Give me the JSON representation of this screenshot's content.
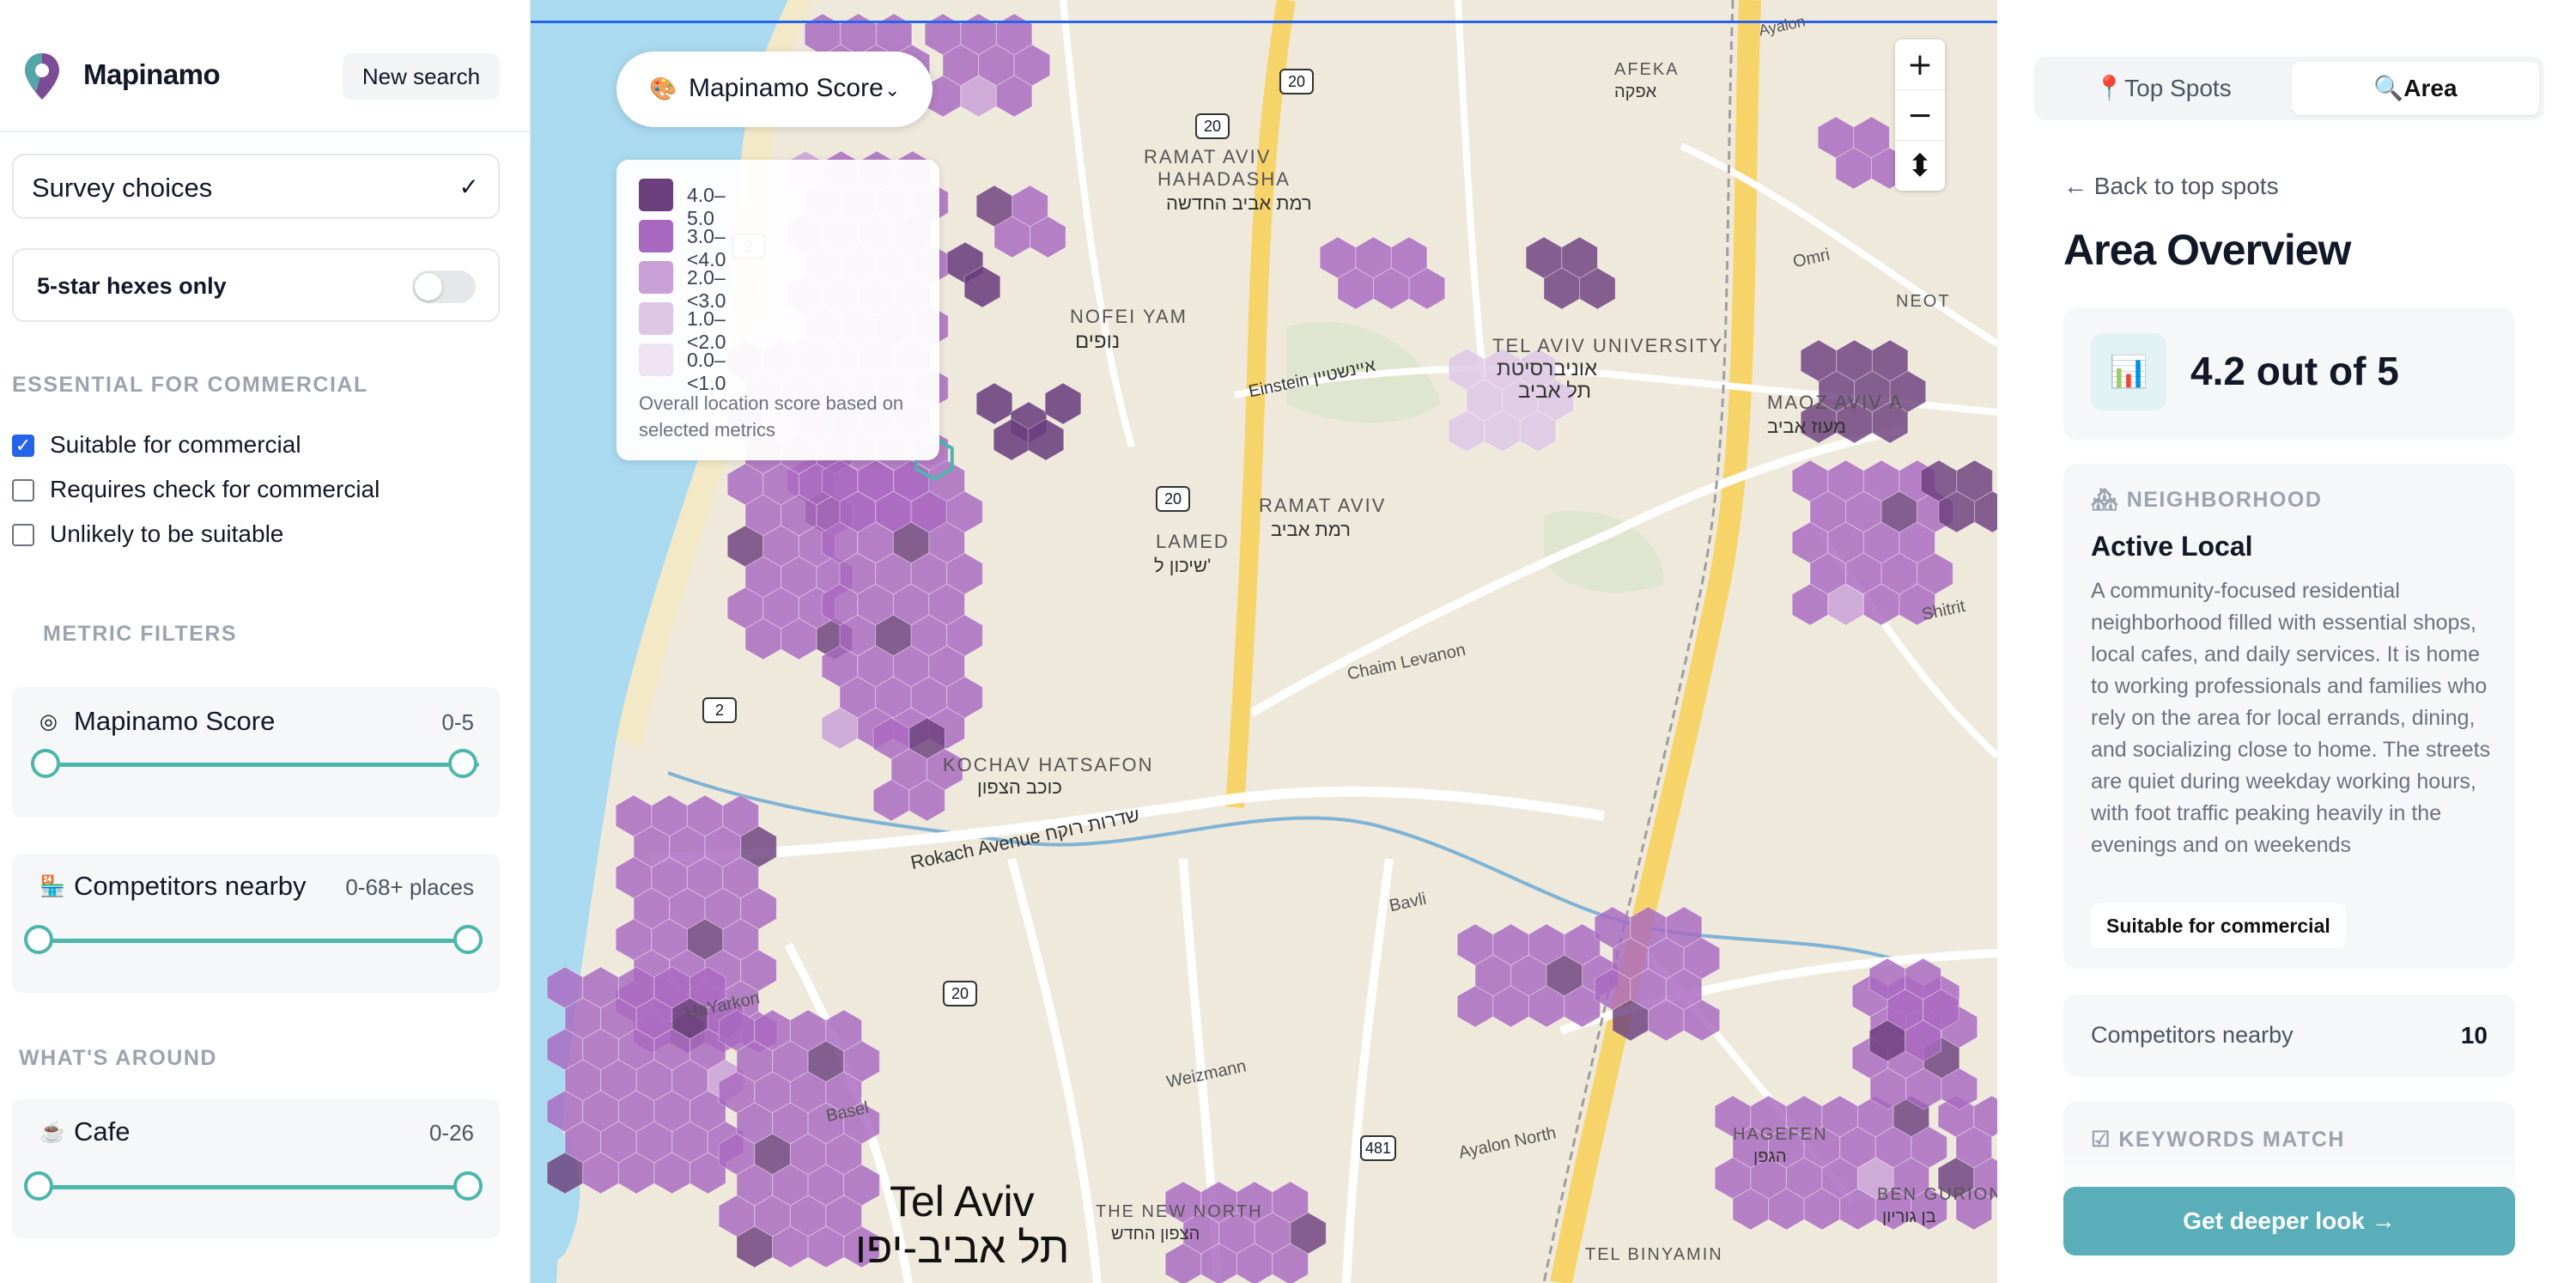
{
  "app": {
    "name": "Mapinamo",
    "new_search_label": "New search"
  },
  "sidebar": {
    "survey_select": "Survey choices",
    "five_star_label": "5-star hexes only",
    "five_star_on": false,
    "essential_heading": "ESSENTIAL FOR COMMERCIAL",
    "checks": [
      {
        "label": "Suitable for commercial",
        "checked": true
      },
      {
        "label": "Requires check for commercial",
        "checked": false
      },
      {
        "label": "Unlikely to be suitable",
        "checked": false
      }
    ],
    "metric_heading": "METRIC FILTERS",
    "metric_filters": [
      {
        "icon": "target-icon",
        "glyph": "◎",
        "label": "Mapinamo Score",
        "range": "0-5"
      },
      {
        "icon": "store-icon",
        "glyph": "🏪",
        "label": "Competitors nearby",
        "range": "0-68+ places"
      }
    ],
    "around_heading": "WHAT'S AROUND",
    "around_filters": [
      {
        "icon": "coffee-icon",
        "glyph": "☕",
        "label": "Cafe",
        "range": "0-26"
      }
    ]
  },
  "map": {
    "score_selector": {
      "icon": "palette-icon",
      "glyph": "🎨",
      "label": "Mapinamo Score"
    },
    "legend": [
      {
        "label": "4.0–5.0",
        "color": "#6b3f7e"
      },
      {
        "label": "3.0–<4.0",
        "color": "#a868c0"
      },
      {
        "label": "2.0–<3.0",
        "color": "#c89fd6"
      },
      {
        "label": "1.0–<2.0",
        "color": "#ddc6e6"
      },
      {
        "label": "0.0–<1.0",
        "color": "#efe3f2"
      }
    ],
    "legend_note": "Overall location score based on selected metrics",
    "zoom_in": "+",
    "zoom_out": "−",
    "compass": "⬍",
    "labels": [
      {
        "text": "RAMAT AVIV",
        "kind": "area"
      },
      {
        "text": "HAHADASHA",
        "kind": "area"
      },
      {
        "text": "רמת אביב החדשה",
        "kind": "area-he"
      },
      {
        "text": "NOFEI YAM",
        "kind": "area"
      },
      {
        "text": "נופים",
        "kind": "area-he"
      },
      {
        "text": "TEL AVIV UNIVERSITY",
        "kind": "area"
      },
      {
        "text": "אוניברסיטת",
        "kind": "area-he"
      },
      {
        "text": "תל אביב",
        "kind": "area-he"
      },
      {
        "text": "RAMAT AVIV",
        "kind": "area"
      },
      {
        "text": "רמת אביב",
        "kind": "area-he"
      },
      {
        "text": "LAMED",
        "kind": "area"
      },
      {
        "text": "שיכון ל'",
        "kind": "area-he"
      },
      {
        "text": "MAOZ AVIV A",
        "kind": "area"
      },
      {
        "text": "מעוז אביב",
        "kind": "area-he"
      },
      {
        "text": "AFEKA",
        "kind": "area"
      },
      {
        "text": "אפקה",
        "kind": "area-he"
      },
      {
        "text": "NEOT",
        "kind": "area"
      },
      {
        "text": "KOCHAV HATSAFON",
        "kind": "area"
      },
      {
        "text": "כוכב הצפון",
        "kind": "area-he"
      },
      {
        "text": "Rokach Avenue שדרות רוקח",
        "kind": "street"
      },
      {
        "text": "Chaim Levanon",
        "kind": "street"
      },
      {
        "text": "Einstein איינשטיין",
        "kind": "street"
      },
      {
        "text": "Shitrit",
        "kind": "street"
      },
      {
        "text": "Bavli",
        "kind": "street"
      },
      {
        "text": "HaYarkon",
        "kind": "street"
      },
      {
        "text": "Tel Aviv",
        "kind": "city"
      },
      {
        "text": "תל אביב-יפו",
        "kind": "city-he"
      },
      {
        "text": "THE NEW NORTH",
        "kind": "area"
      },
      {
        "text": "הצפון החדש",
        "kind": "area-he"
      },
      {
        "text": "HAGEFEN",
        "kind": "area"
      },
      {
        "text": "הגפן",
        "kind": "area-he"
      },
      {
        "text": "BEN GURION",
        "kind": "area"
      },
      {
        "text": "בן גוריון",
        "kind": "area-he"
      },
      {
        "text": "TEL BINYAMIN",
        "kind": "area"
      },
      {
        "text": "Ayalon",
        "kind": "street"
      },
      {
        "text": "Basel",
        "kind": "street"
      },
      {
        "text": "Weizmann",
        "kind": "street"
      },
      {
        "text": "Ayalon North",
        "kind": "street"
      },
      {
        "text": "Omri",
        "kind": "street"
      }
    ],
    "road_shields": [
      "20",
      "2",
      "2",
      "20",
      "20",
      "20",
      "481"
    ]
  },
  "panel": {
    "tabs": [
      {
        "icon": "pin-icon",
        "glyph": "📍",
        "label": "Top Spots",
        "active": false
      },
      {
        "icon": "magnifier-icon",
        "glyph": "🔍",
        "label": "Area",
        "active": true
      }
    ],
    "back_label": "← Back to top spots",
    "title": "Area Overview",
    "score_icon": "📊",
    "score_text": "4.2 out of 5",
    "neighborhood": {
      "icon": "🏘",
      "heading": "NEIGHBORHOOD",
      "name": "Active Local",
      "description": "A community-focused residential neighborhood filled with essential shops, local cafes, and daily services. It is home to working professionals and families who rely on the area for local errands, dining, and socializing close to home. The streets are quiet during weekday working hours, with foot traffic peaking heavily in the evenings and on weekends",
      "badge": "Suitable for commercial"
    },
    "competitors": {
      "label": "Competitors nearby",
      "value": "10"
    },
    "keywords": {
      "icon": "☑",
      "heading": "KEYWORDS MATCH"
    },
    "cta_label": "Get deeper look →"
  }
}
